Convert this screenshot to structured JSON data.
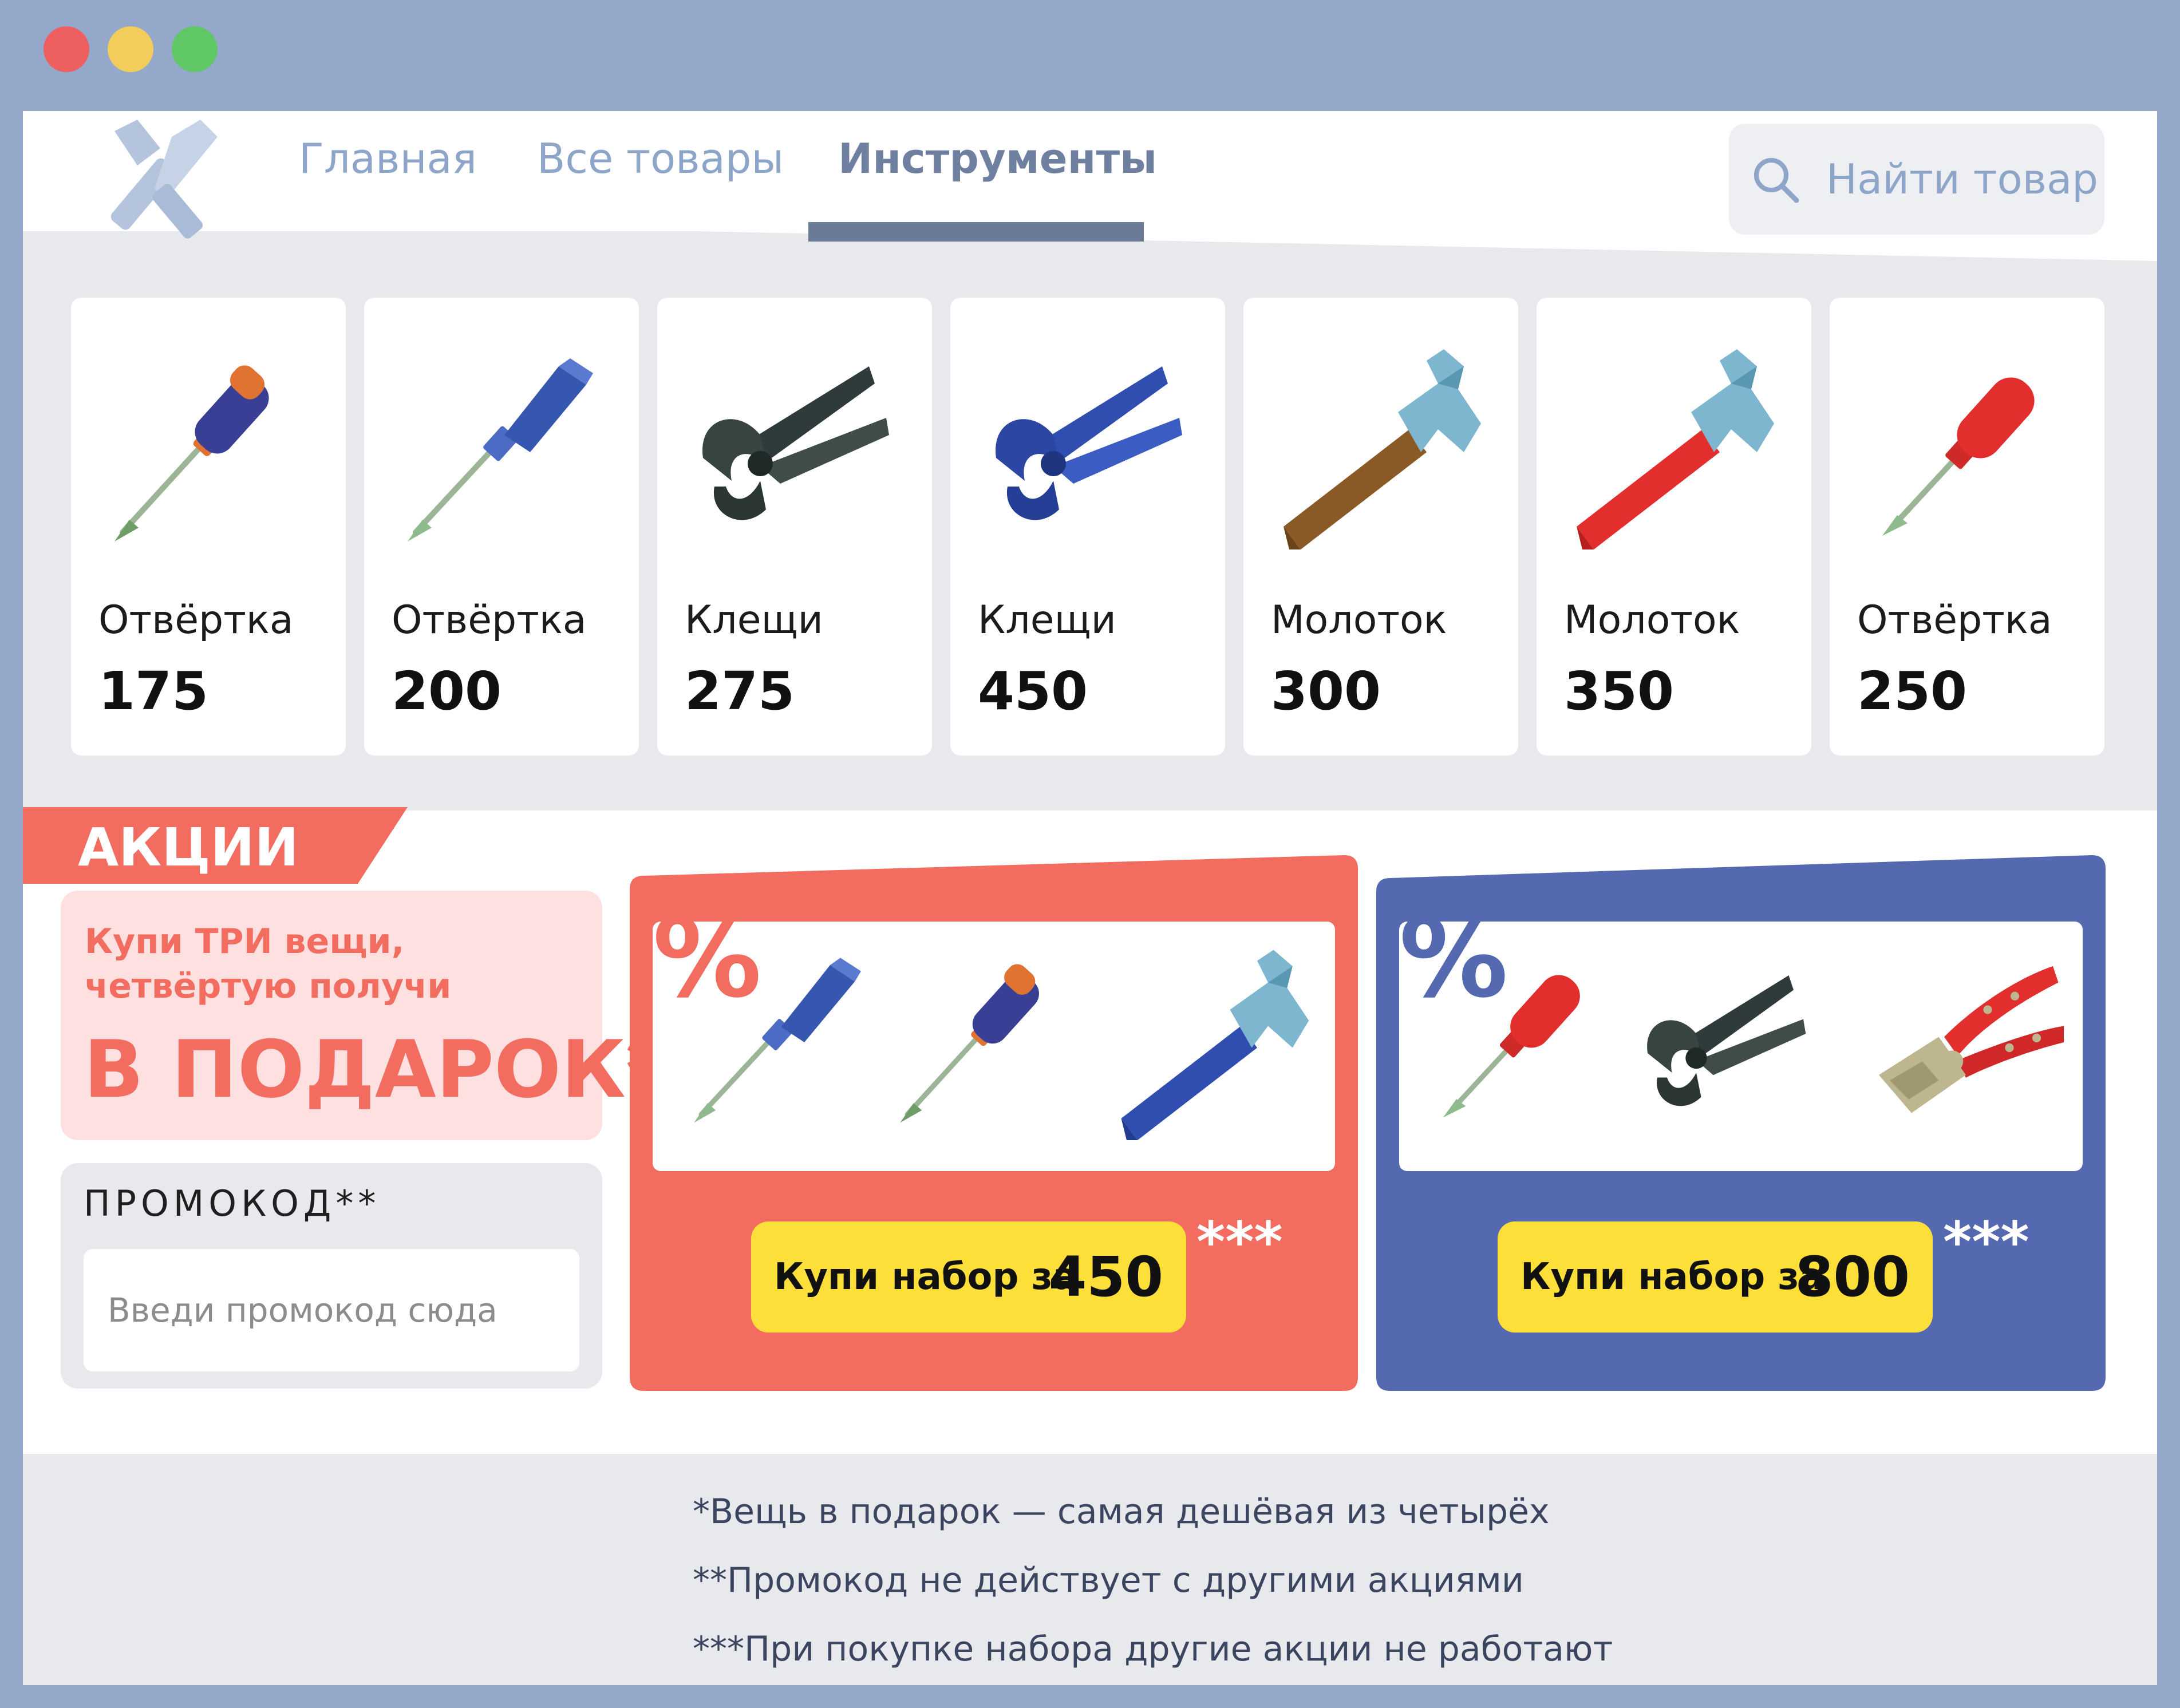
{
  "window": {
    "controls": [
      {
        "name": "close",
        "color": "#ee5f5f"
      },
      {
        "name": "minimize",
        "color": "#f2cd5c"
      },
      {
        "name": "maximize",
        "color": "#5fc765"
      }
    ]
  },
  "header": {
    "logo_icon": "hammer-screwdriver-logo-icon",
    "nav": [
      {
        "label": "Главная"
      },
      {
        "label": "Все товары"
      },
      {
        "label": "Инструменты",
        "active": true
      }
    ],
    "search": {
      "placeholder": "Найти товар",
      "icon": "search-icon"
    }
  },
  "products": [
    {
      "name": "Отвёртка",
      "price": "175",
      "icon": "screwdriver-blue-orange-icon"
    },
    {
      "name": "Отвёртка",
      "price": "200",
      "icon": "screwdriver-blue-icon"
    },
    {
      "name": "Клещи",
      "price": "275",
      "icon": "pincers-dark-icon"
    },
    {
      "name": "Клещи",
      "price": "450",
      "icon": "pincers-blue-icon"
    },
    {
      "name": "Молоток",
      "price": "300",
      "icon": "hammer-wood-icon"
    },
    {
      "name": "Молоток",
      "price": "350",
      "icon": "hammer-red-icon"
    },
    {
      "name": "Отвёртка",
      "price": "250",
      "icon": "screwdriver-red-icon"
    }
  ],
  "promotions": {
    "section_title": "АКЦИИ",
    "gift": {
      "line1": "Купи ТРИ вещи,",
      "line2": "четвёртую получи",
      "headline": "В ПОДАРОК*"
    },
    "promocode": {
      "label": "ПРОМОКОД**",
      "placeholder": "Введи промокод сюда"
    },
    "sets": [
      {
        "badge": "%",
        "button_label": "Купи набор за",
        "price": "450",
        "stars": "***",
        "color": "#f26c5f",
        "items": [
          "screwdriver-blue-icon",
          "screwdriver-blue-orange-icon",
          "hammer-blue-icon"
        ]
      },
      {
        "badge": "%",
        "button_label": "Купи набор за",
        "price": "800",
        "stars": "***",
        "color": "#5469b0",
        "items": [
          "screwdriver-red-icon",
          "pincers-dark-icon",
          "pliers-red-icon"
        ]
      }
    ]
  },
  "footnotes": [
    "*Вещь в подарок — самая дешёвая из четырёх",
    "**Промокод не действует с другими акциями",
    "***При покупке набора другие акции не работают"
  ],
  "colors": {
    "frame": "#94a8c9",
    "accent_red": "#f26c5f",
    "accent_blue": "#5469b0",
    "button_yellow": "#fddf3a",
    "panel_gray": "#e8e9ed"
  }
}
